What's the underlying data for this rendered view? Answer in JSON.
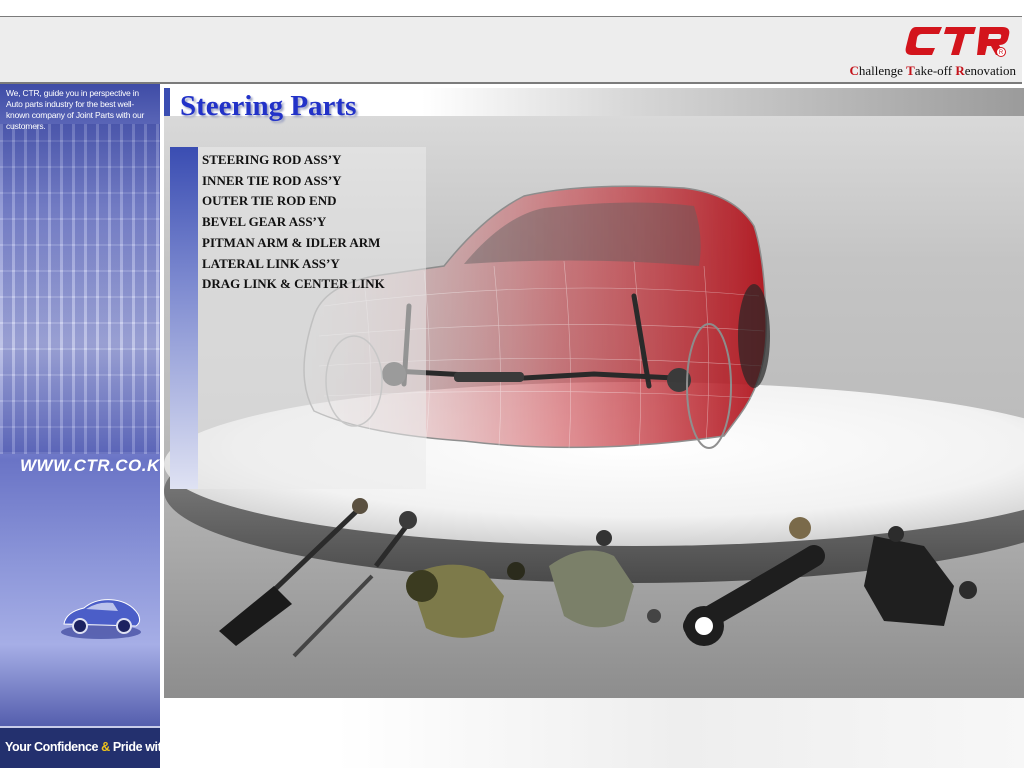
{
  "header": {
    "brand": "CTR",
    "tagline": [
      {
        "initial": "C",
        "rest": "hallenge "
      },
      {
        "initial": "T",
        "rest": "ake-off "
      },
      {
        "initial": "R",
        "rest": "enovation"
      }
    ]
  },
  "sidebar": {
    "intro": "We, CTR, guide you in perspective in Auto parts industry for the best well-known company of Joint Parts with our customers.",
    "url": "WWW.CTR.CO.KR",
    "footer": {
      "part1": "Your Confidence ",
      "amp": "&",
      "part2": " Pride with"
    }
  },
  "slide": {
    "title": "Steering Parts",
    "parts": [
      "STEERING ROD ASS’Y",
      "INNER TIE ROD ASS’Y",
      "OUTER TIE ROD END",
      "BEVEL GEAR ASS’Y",
      "PITMAN ARM & IDLER ARM",
      "LATERAL LINK ASS’Y",
      "DRAG LINK & CENTER LINK"
    ]
  },
  "colors": {
    "brand_red": "#c4121a",
    "title_blue": "#2232c8",
    "sidebar_blue": "#3f4ca6"
  }
}
